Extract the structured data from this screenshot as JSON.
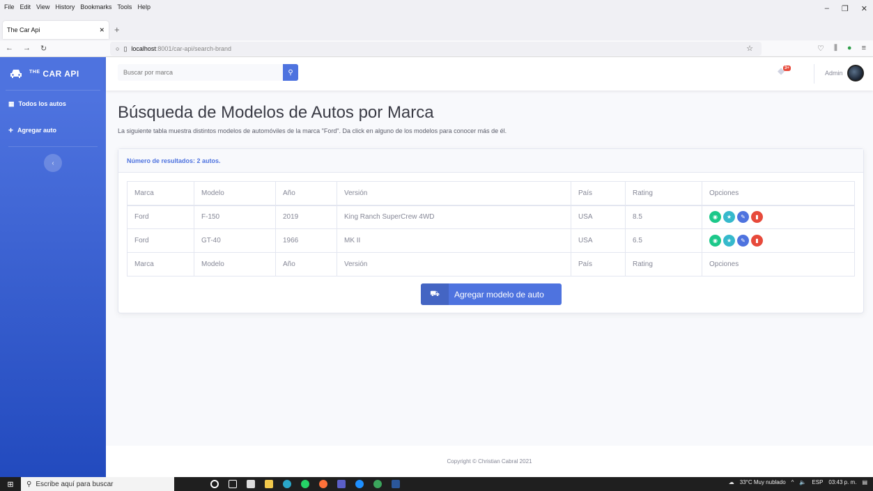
{
  "browser": {
    "menu": [
      "File",
      "Edit",
      "View",
      "History",
      "Bookmarks",
      "Tools",
      "Help"
    ],
    "tab_title": "The Car Api",
    "url_host": "localhost",
    "url_path": ":8001/car-api/search-brand"
  },
  "sidebar": {
    "brand_sup": "THE",
    "brand": "CAR API",
    "items": [
      {
        "label": "Todos los autos",
        "icon": "table-icon"
      },
      {
        "label": "Agregar auto",
        "icon": "plus-icon"
      }
    ]
  },
  "topbar": {
    "search_placeholder": "Buscar por marca",
    "alert_count": "3+",
    "user_name": "Admin"
  },
  "main": {
    "title": "Búsqueda de Modelos de Autos por Marca",
    "description": "La siguiente tabla muestra distintos modelos de automóviles de la marca \"Ford\". Da click en alguno de los modelos para conocer más de él.",
    "results_label": "Número de resultados: 2 autos.",
    "columns": [
      "Marca",
      "Modelo",
      "Año",
      "Versión",
      "País",
      "Rating",
      "Opciones"
    ],
    "rows": [
      {
        "marca": "Ford",
        "modelo": "F-150",
        "anio": "2019",
        "version": "King Ranch SuperCrew 4WD",
        "pais": "USA",
        "rating": "8.5"
      },
      {
        "marca": "Ford",
        "modelo": "GT-40",
        "anio": "1966",
        "version": "MK II",
        "pais": "USA",
        "rating": "6.5"
      }
    ],
    "add_button": "Agregar modelo de auto"
  },
  "footer": "Copyright © Christian Cabral 2021",
  "taskbar": {
    "search": "Escribe aquí para buscar",
    "weather": "33°C  Muy nublado",
    "lang": "ESP",
    "time": "03:43 p. m."
  },
  "colors": {
    "primary": "#4e73df",
    "success": "#1cc88a",
    "info": "#36b9cc",
    "danger": "#e74a3b"
  }
}
